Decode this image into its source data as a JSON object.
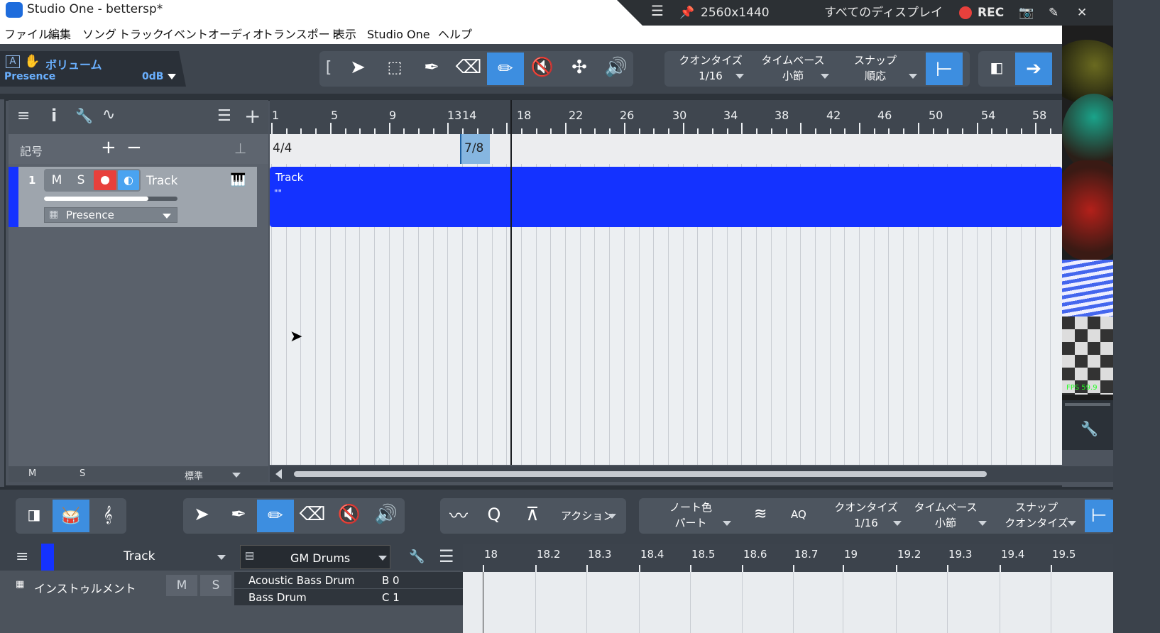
{
  "window": {
    "title": "Studio One - bettersp*"
  },
  "recorder": {
    "resolution": "2560x1440",
    "display": "すべてのディスプレイ",
    "rec": "REC"
  },
  "menu": [
    "ファイル",
    "編集",
    "ソング",
    "トラック",
    "イベント",
    "オーディオ",
    "トランスポート",
    "表示",
    "Studio One",
    "ヘルプ"
  ],
  "context": {
    "label": "ボリューム",
    "device": "Presence",
    "value": "0dB"
  },
  "toolbar": {
    "quantize_label": "クオンタイズ",
    "quantize_value": "1/16",
    "timebase_label": "タイムベース",
    "timebase_value": "小節",
    "snap_label": "スナップ",
    "snap_value": "順応"
  },
  "ruler": {
    "marks": [
      "1",
      "5",
      "9",
      "13",
      "14",
      "18",
      "22",
      "26",
      "30",
      "34",
      "38",
      "42",
      "46",
      "50",
      "54",
      "58"
    ]
  },
  "signature": {
    "row_label": "記号",
    "sig1": "4/4",
    "sig2": "7/8"
  },
  "track": {
    "number": "1",
    "mute": "M",
    "solo": "S",
    "name": "Track",
    "instrument": "Presence",
    "volume_level": 0.78
  },
  "part": {
    "label": "Track",
    "sub": "\"\""
  },
  "footer": {
    "m": "M",
    "s": "S",
    "mode": "標準"
  },
  "editor": {
    "action": "アクション",
    "notecolor_label": "ノート色",
    "notecolor_value": "パート",
    "aq": "AQ",
    "quantize_label": "クオンタイズ",
    "quantize_value": "1/16",
    "timebase_label": "タイムベース",
    "timebase_value": "小節",
    "snap_label": "スナップ",
    "snap_value": "クオンタイズ",
    "track_name": "Track",
    "drum_map": "GM Drums",
    "instrument_label": "インストゥルメント",
    "m": "M",
    "s": "S",
    "notes": [
      {
        "name": "Acoustic Bass Drum",
        "pitch": "B 0"
      },
      {
        "name": "Bass Drum",
        "pitch": "C 1"
      }
    ],
    "ruler": [
      "18",
      "18.2",
      "18.3",
      "18.4",
      "18.5",
      "18.6",
      "18.7",
      "19",
      "19.2",
      "19.3",
      "19.4",
      "19.5"
    ]
  },
  "fps": "FPS 59.9",
  "colors": {
    "accent": "#3d8ee0",
    "part": "#1432ff",
    "record": "#e8403c"
  }
}
